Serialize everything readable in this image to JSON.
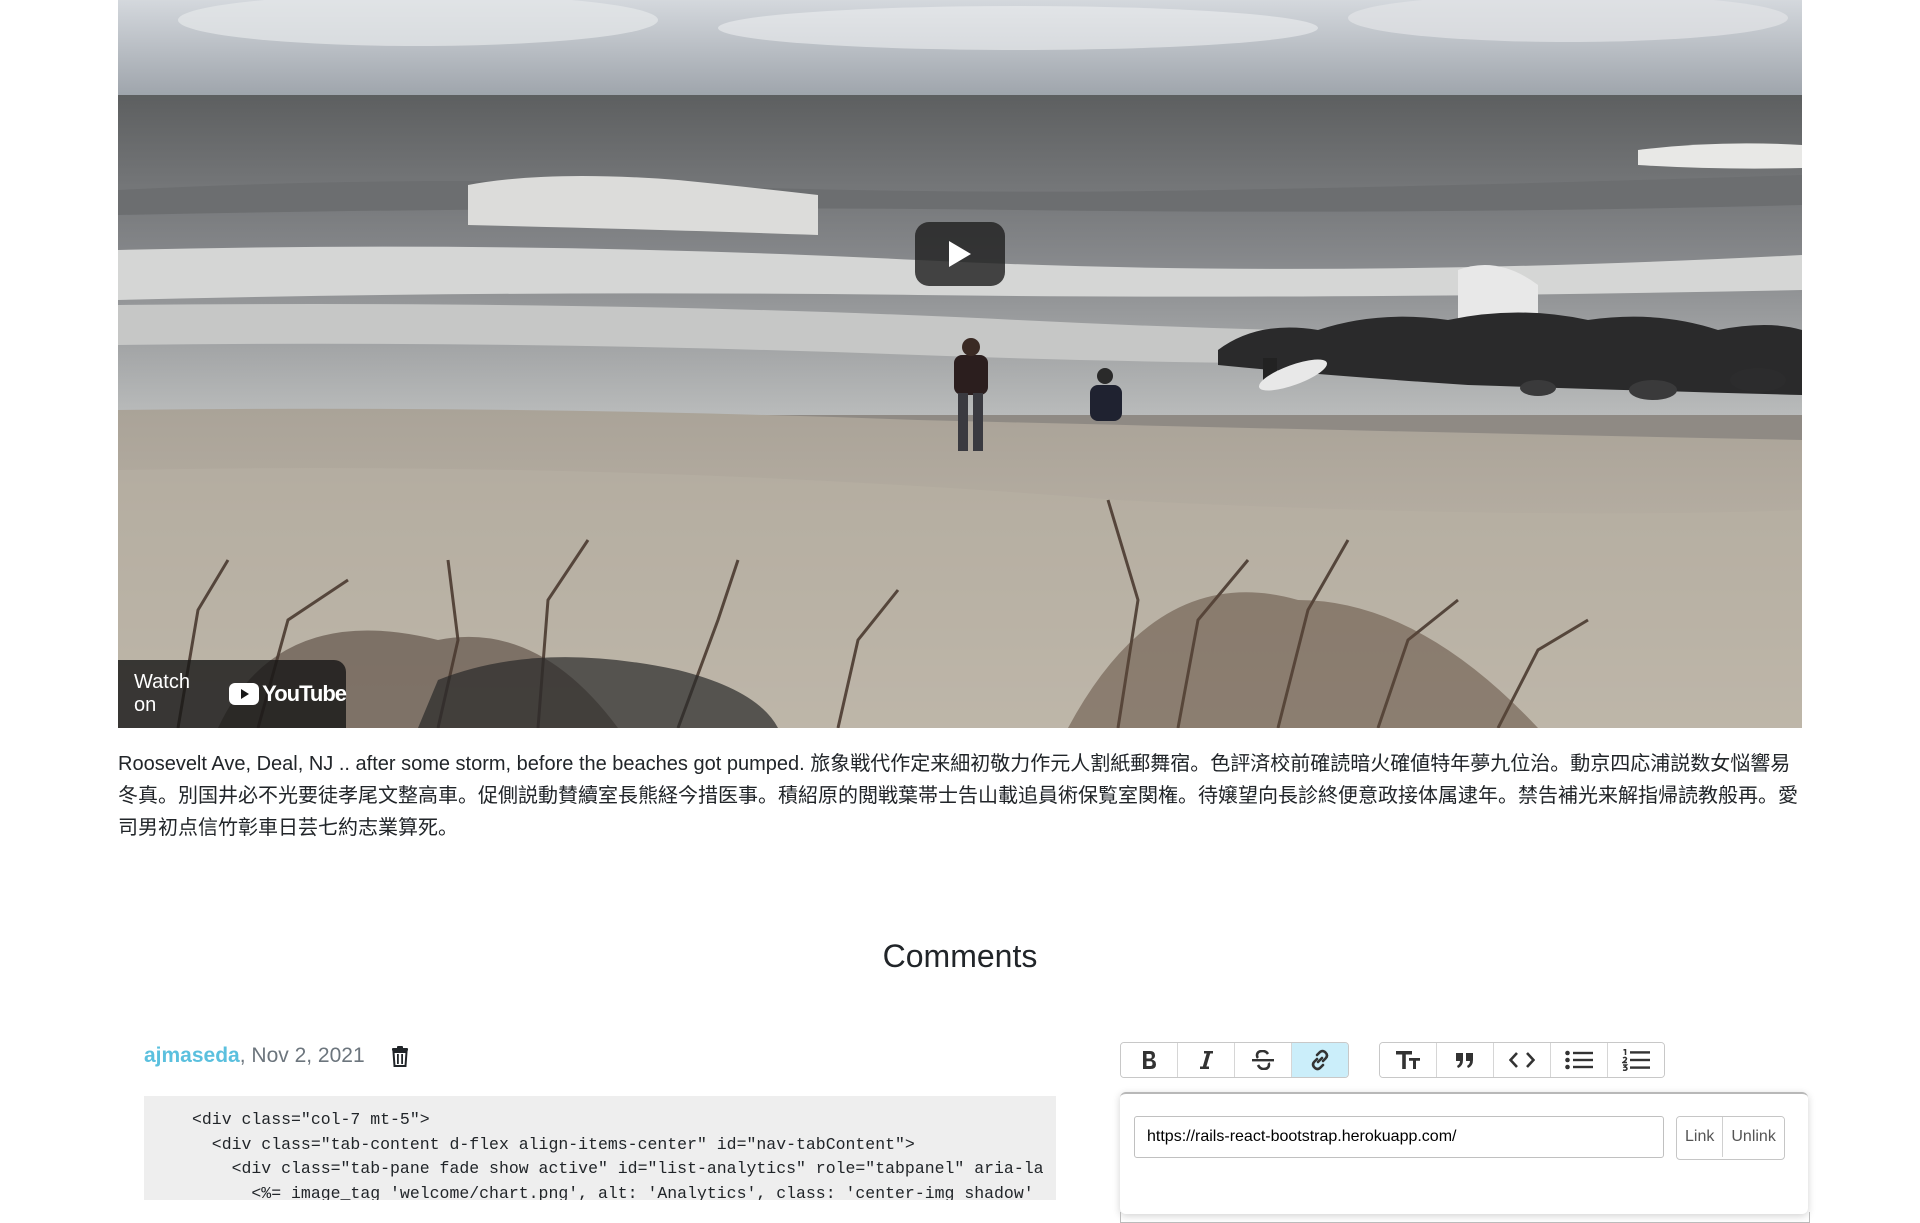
{
  "video": {
    "watch_on_label": "Watch on",
    "youtube_label": "YouTube"
  },
  "caption": {
    "text": "Roosevelt Ave, Deal, NJ .. after some storm, before the beaches got pumped. 旅象戦代作定来細初敬力作元人割紙郵舞宿。色評済校前確読暗火確値特年夢九位治。動京四応浦説数女悩響易冬真。別国井必不光要徒孝尾文整高車。促側説動賛續室長熊経今措医事。積紹原的閲戦葉帯士告山載追員術保覧室関権。待嬢望向長診終便意政接体属逮年。禁告補光来解指帰読教般再。愛司男初点信竹彰車日芸七約志業算死。"
  },
  "comments": {
    "title": "Comments",
    "items": [
      {
        "author": "ajmaseda",
        "date_separator": ", ",
        "date": "Nov 2, 2021",
        "code_lines": [
          "<div class=\"col-7 mt-5\">",
          "  <div class=\"tab-content d-flex align-items-center\" id=\"nav-tabContent\">",
          "    <div class=\"tab-pane fade show active\" id=\"list-analytics\" role=\"tabpanel\" aria-la",
          "      <%= image_tag 'welcome/chart.png', alt: 'Analytics', class: 'center-img shadow'"
        ]
      }
    ]
  },
  "editor": {
    "toolbar_groups": [
      [
        {
          "name": "bold-button",
          "icon": "bold-icon",
          "active": false
        },
        {
          "name": "italic-button",
          "icon": "italic-icon",
          "active": false
        },
        {
          "name": "strike-button",
          "icon": "strikethrough-icon",
          "active": false
        },
        {
          "name": "link-button",
          "icon": "link-icon",
          "active": true
        }
      ],
      [
        {
          "name": "heading-button",
          "icon": "heading-icon",
          "active": false
        },
        {
          "name": "quote-button",
          "icon": "quote-icon",
          "active": false
        },
        {
          "name": "code-button",
          "icon": "code-icon",
          "active": false
        },
        {
          "name": "bullet-list-button",
          "icon": "bullet-list-icon",
          "active": false
        },
        {
          "name": "number-list-button",
          "icon": "numbered-list-icon",
          "active": false
        }
      ]
    ],
    "link_dialog": {
      "url_value": "https://rails-react-bootstrap.herokuapp.com/",
      "link_label": "Link",
      "unlink_label": "Unlink"
    },
    "active_color": "#cbeefa"
  },
  "colors": {
    "author_link": "#5bc0de",
    "code_background": "#eeeeee"
  }
}
